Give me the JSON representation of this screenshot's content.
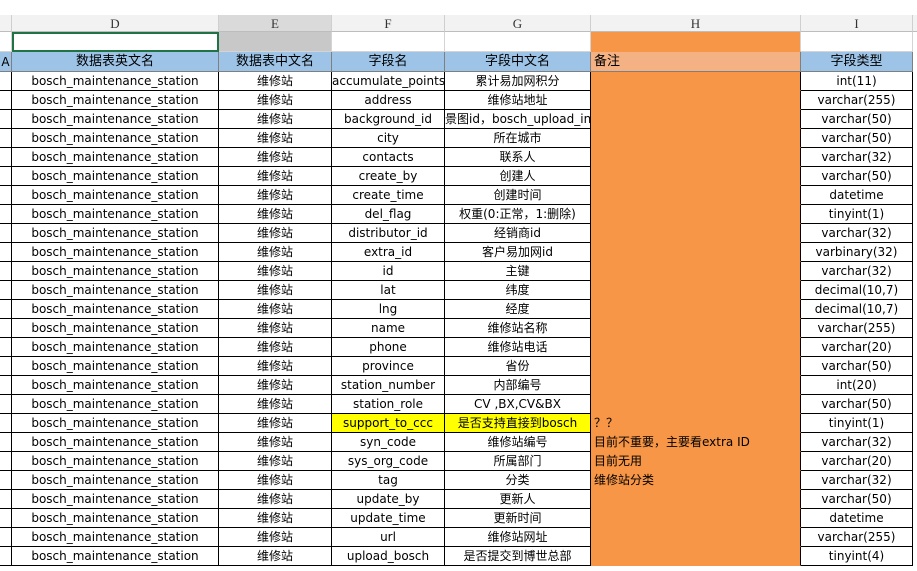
{
  "columns": [
    "D",
    "E",
    "F",
    "G",
    "H",
    "I"
  ],
  "header": {
    "a": "A",
    "d": "数据表英文名",
    "e": "数据表中文名",
    "f": "字段名",
    "g": "字段中文名",
    "h": "备注",
    "i": "字段类型"
  },
  "rows": [
    {
      "d": "bosch_maintenance_station",
      "e": "维修站",
      "f": "accumulate_points",
      "g": "累计易加网积分",
      "h": "",
      "i": "int(11)"
    },
    {
      "d": "bosch_maintenance_station",
      "e": "维修站",
      "f": "address",
      "g": "维修站地址",
      "h": "",
      "i": "varchar(255)"
    },
    {
      "d": "bosch_maintenance_station",
      "e": "维修站",
      "f": "background_id",
      "g": "景图id，bosch_upload_info.id",
      "h": "",
      "i": "varchar(50)"
    },
    {
      "d": "bosch_maintenance_station",
      "e": "维修站",
      "f": "city",
      "g": "所在城市",
      "h": "",
      "i": "varchar(50)"
    },
    {
      "d": "bosch_maintenance_station",
      "e": "维修站",
      "f": "contacts",
      "g": "联系人",
      "h": "",
      "i": "varchar(32)"
    },
    {
      "d": "bosch_maintenance_station",
      "e": "维修站",
      "f": "create_by",
      "g": "创建人",
      "h": "",
      "i": "varchar(50)"
    },
    {
      "d": "bosch_maintenance_station",
      "e": "维修站",
      "f": "create_time",
      "g": "创建时间",
      "h": "",
      "i": "datetime"
    },
    {
      "d": "bosch_maintenance_station",
      "e": "维修站",
      "f": "del_flag",
      "g": "权重(0:正常，1:删除)",
      "h": "",
      "i": "tinyint(1)"
    },
    {
      "d": "bosch_maintenance_station",
      "e": "维修站",
      "f": "distributor_id",
      "g": "经销商id",
      "h": "",
      "i": "varchar(32)"
    },
    {
      "d": "bosch_maintenance_station",
      "e": "维修站",
      "f": "extra_id",
      "g": "客户易加网id",
      "h": "",
      "i": "varbinary(32)"
    },
    {
      "d": "bosch_maintenance_station",
      "e": "维修站",
      "f": "id",
      "g": "主键",
      "h": "",
      "i": "varchar(32)"
    },
    {
      "d": "bosch_maintenance_station",
      "e": "维修站",
      "f": "lat",
      "g": "纬度",
      "h": "",
      "i": "decimal(10,7)"
    },
    {
      "d": "bosch_maintenance_station",
      "e": "维修站",
      "f": "lng",
      "g": "经度",
      "h": "",
      "i": "decimal(10,7)"
    },
    {
      "d": "bosch_maintenance_station",
      "e": "维修站",
      "f": "name",
      "g": "维修站名称",
      "h": "",
      "i": "varchar(255)"
    },
    {
      "d": "bosch_maintenance_station",
      "e": "维修站",
      "f": "phone",
      "g": "维修站电话",
      "h": "",
      "i": "varchar(20)"
    },
    {
      "d": "bosch_maintenance_station",
      "e": "维修站",
      "f": "province",
      "g": "省份",
      "h": "",
      "i": "varchar(50)"
    },
    {
      "d": "bosch_maintenance_station",
      "e": "维修站",
      "f": "station_number",
      "g": "内部编号",
      "h": "",
      "i": "int(20)"
    },
    {
      "d": "bosch_maintenance_station",
      "e": "维修站",
      "f": "station_role",
      "g": "CV ,BX,CV&BX",
      "h": "",
      "i": "varchar(50)"
    },
    {
      "d": "bosch_maintenance_station",
      "e": "维修站",
      "f": "support_to_ccc",
      "g": "是否支持直接到bosch",
      "h": "？？",
      "i": "tinyint(1)",
      "highlight": true
    },
    {
      "d": "bosch_maintenance_station",
      "e": "维修站",
      "f": "syn_code",
      "g": "维修站编号",
      "h": "目前不重要，主要看extra ID",
      "i": "varchar(32)"
    },
    {
      "d": "bosch_maintenance_station",
      "e": "维修站",
      "f": "sys_org_code",
      "g": "所属部门",
      "h": "目前无用",
      "i": "varchar(20)"
    },
    {
      "d": "bosch_maintenance_station",
      "e": "维修站",
      "f": "tag",
      "g": "分类",
      "h": "维修站分类",
      "i": "varchar(32)"
    },
    {
      "d": "bosch_maintenance_station",
      "e": "维修站",
      "f": "update_by",
      "g": "更新人",
      "h": "",
      "i": "varchar(50)"
    },
    {
      "d": "bosch_maintenance_station",
      "e": "维修站",
      "f": "update_time",
      "g": "更新时间",
      "h": "",
      "i": "datetime"
    },
    {
      "d": "bosch_maintenance_station",
      "e": "维修站",
      "f": "url",
      "g": "维修站网址",
      "h": "",
      "i": "varchar(255)"
    },
    {
      "d": "bosch_maintenance_station",
      "e": "维修站",
      "f": "upload_bosch",
      "g": "是否提交到博世总部",
      "h": "",
      "i": "tinyint(4)"
    }
  ],
  "colors": {
    "header_fill": "#9dc3e6",
    "note_fill": "#f79646",
    "highlight": "#ffff00"
  }
}
